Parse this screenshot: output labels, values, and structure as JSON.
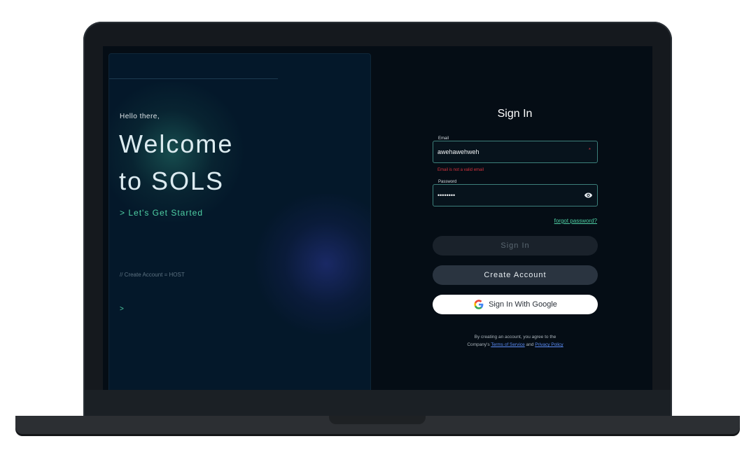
{
  "hero": {
    "greeting": "Hello there,",
    "title_line1": "Welcome",
    "title_line2": "to SOLS",
    "cta": "> Let's Get Started",
    "host_note": "// Create Account = HOST",
    "prompt": ">"
  },
  "form": {
    "title": "Sign In",
    "email": {
      "label": "Email",
      "value": "awehawehweh",
      "required_marker": "*",
      "error": "Email is not a valid email"
    },
    "password": {
      "label": "Password",
      "value": "••••••••",
      "toggle_icon": "eye-icon"
    },
    "forgot_link": "forgot password?",
    "signin_button": "Sign In",
    "create_button": "Create Account",
    "google_button": "Sign In With Google",
    "legal": {
      "line1": "By creating an account, you agree to the",
      "prefix": "Company's",
      "terms": "Terms of Service",
      "and": "and",
      "privacy": "Privacy Policy"
    }
  },
  "colors": {
    "accent": "#4fd0a5",
    "field_border": "#3c7f7a",
    "error": "#d6333d",
    "link": "#5b8cf5",
    "background": "#050d15"
  }
}
